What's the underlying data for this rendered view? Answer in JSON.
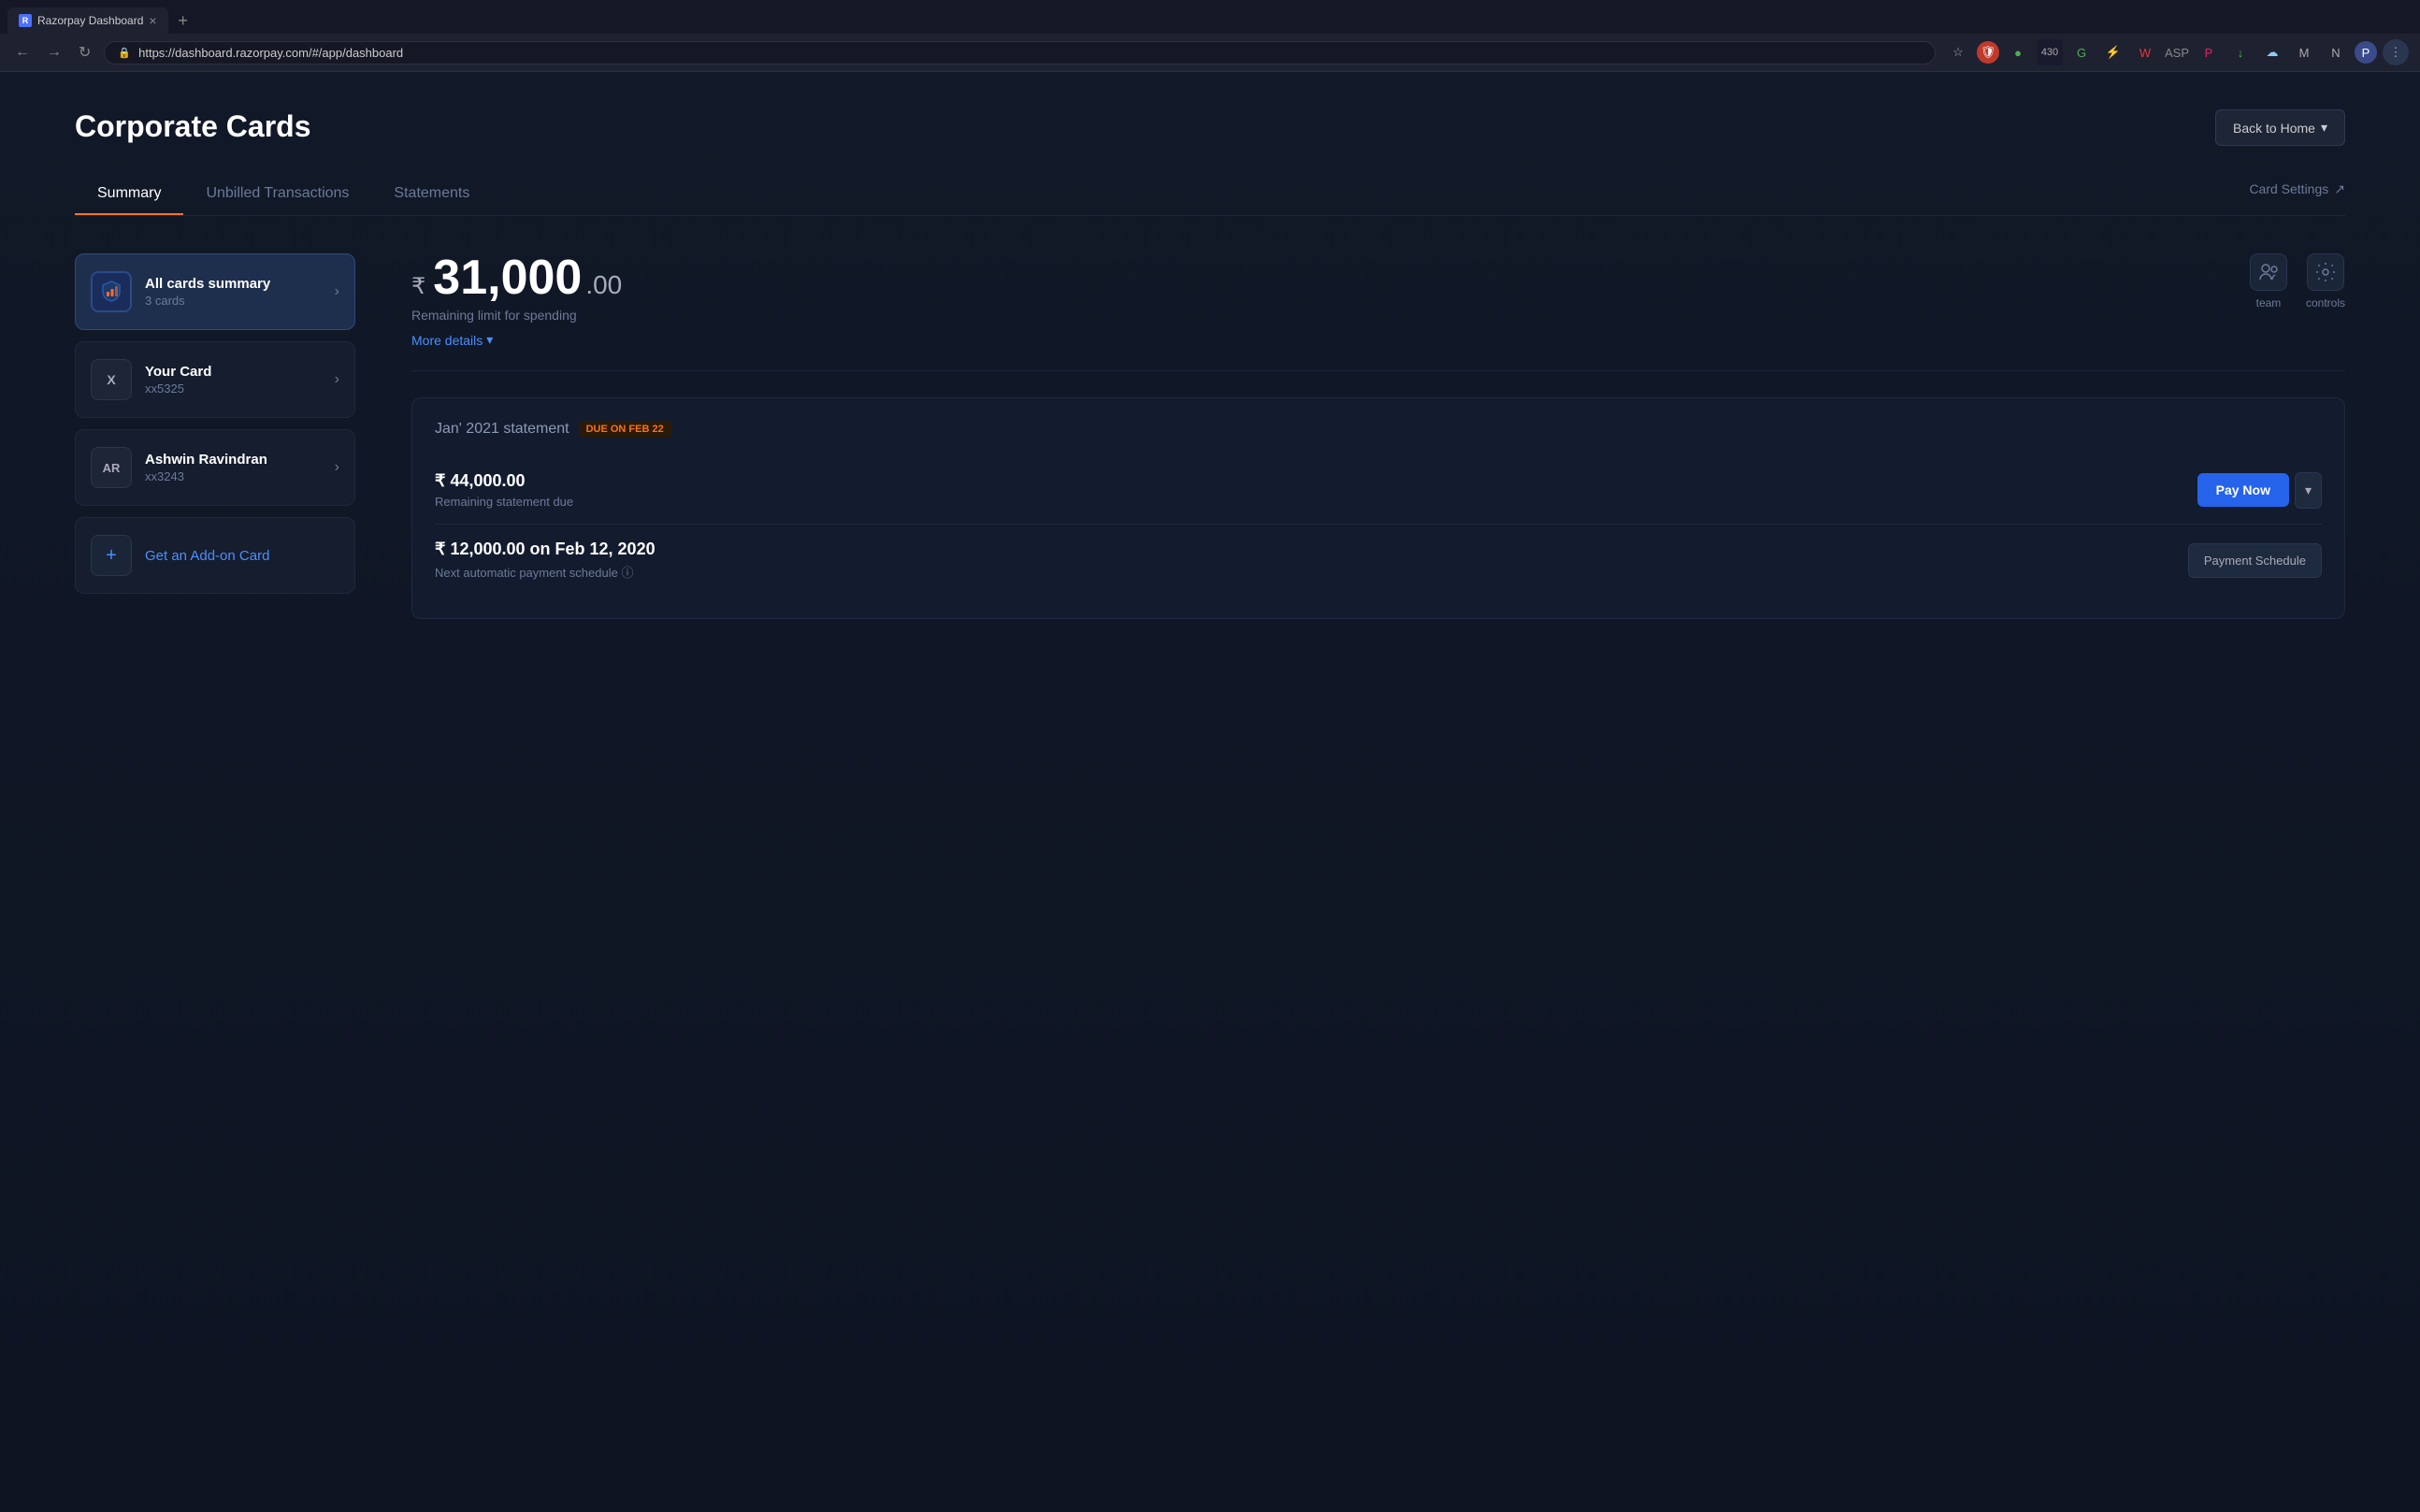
{
  "browser": {
    "tab_title": "Razorpay Dashboard",
    "favicon_text": "R",
    "url": "https://dashboard.razorpay.com/#/app/dashboard",
    "new_tab_label": "+",
    "close_tab_label": "×"
  },
  "header": {
    "page_title": "Corporate Cards",
    "back_to_home_label": "Back to Home"
  },
  "tabs": [
    {
      "label": "Summary",
      "active": true
    },
    {
      "label": "Unbilled Transactions",
      "active": false
    },
    {
      "label": "Statements",
      "active": false
    }
  ],
  "card_settings_label": "Card Settings",
  "cards": [
    {
      "id": "all-cards-summary",
      "icon_text": "📊",
      "icon_type": "summary",
      "name": "All cards summary",
      "sub": "3 cards",
      "active": true
    },
    {
      "id": "your-card",
      "icon_text": "X",
      "icon_type": "your-card",
      "name": "Your Card",
      "sub": "xx5325",
      "active": false
    },
    {
      "id": "ashwin-card",
      "icon_text": "AR",
      "icon_type": "ar-card",
      "name": "Ashwin Ravindran",
      "sub": "xx3243",
      "active": false
    }
  ],
  "add_on_card_label": "Get an Add-on Card",
  "balance": {
    "currency_symbol": "₹",
    "amount_main": "31,000",
    "amount_decimal": ".00",
    "label": "Remaining limit for spending",
    "more_details_label": "More details"
  },
  "actions": [
    {
      "id": "team",
      "icon": "👥",
      "label": "team"
    },
    {
      "id": "controls",
      "icon": "⚙",
      "label": "controls"
    }
  ],
  "statement": {
    "title": "Jan' 2021 statement",
    "due_badge": "DUE ON FEB 22",
    "remaining_due_amount": "₹ 44,000.00",
    "remaining_due_label": "Remaining statement due",
    "pay_now_label": "Pay Now",
    "auto_payment_amount": "₹ 12,000.00 on Feb 12, 2020",
    "auto_payment_label": "Next automatic payment schedule",
    "payment_schedule_label": "Payment Schedule"
  }
}
